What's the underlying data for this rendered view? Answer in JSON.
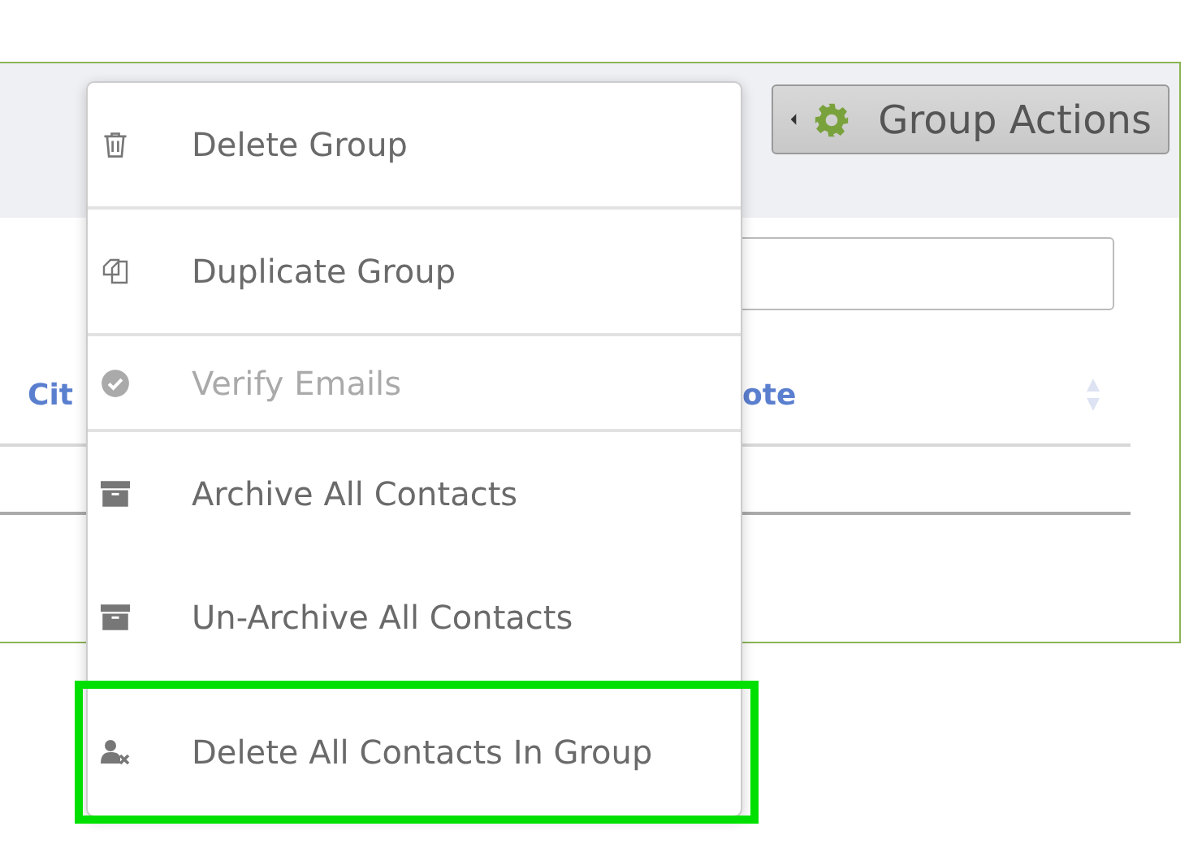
{
  "toolbar": {
    "group_actions_button": {
      "label": "Group Actions"
    }
  },
  "table": {
    "columns": [
      {
        "label": "Cit",
        "sortable": false
      },
      {
        "label": "ote",
        "sortable": true
      }
    ]
  },
  "menu": {
    "items": [
      {
        "kind": "trash",
        "label": "Delete Group",
        "disabled": false,
        "highlighted": false,
        "divider_after": true
      },
      {
        "kind": "copy",
        "label": "Duplicate Group",
        "disabled": false,
        "highlighted": false,
        "divider_after": true
      },
      {
        "kind": "check",
        "label": "Verify Emails",
        "disabled": true,
        "highlighted": false,
        "divider_after": true
      },
      {
        "kind": "archive",
        "label": "Archive All Contacts",
        "disabled": false,
        "highlighted": false,
        "divider_after": false
      },
      {
        "kind": "archive",
        "label": "Un-Archive All Contacts",
        "disabled": false,
        "highlighted": false,
        "divider_after": false
      },
      {
        "kind": "user-x",
        "label": "Delete All Contacts In Group",
        "disabled": false,
        "highlighted": true,
        "divider_after": false
      }
    ]
  }
}
